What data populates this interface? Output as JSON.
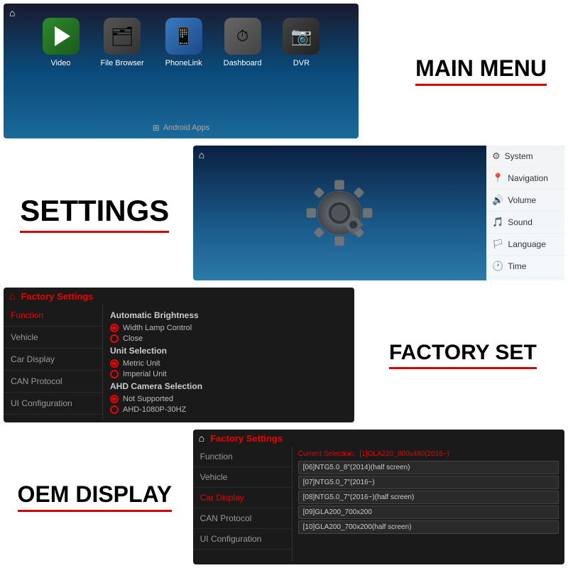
{
  "header": {
    "home_icon": "⌂"
  },
  "main_menu": {
    "title": "MAIN MENU",
    "icons": [
      {
        "id": "video",
        "label": "Video",
        "icon": "▶"
      },
      {
        "id": "file_browser",
        "label": "File Browser",
        "icon": "📁"
      },
      {
        "id": "phonelink",
        "label": "PhoneLink",
        "icon": "📱"
      },
      {
        "id": "dashboard",
        "label": "Dashboard",
        "icon": "🕐"
      },
      {
        "id": "dvr",
        "label": "DVR",
        "icon": "📷"
      }
    ],
    "android_apps": "Android Apps"
  },
  "settings": {
    "title": "SETTINGS",
    "menu_items": [
      {
        "id": "system",
        "label": "System",
        "icon": "⚙"
      },
      {
        "id": "navigation",
        "label": "Navigation",
        "icon": "📍"
      },
      {
        "id": "volume",
        "label": "Volume",
        "icon": "🔊"
      },
      {
        "id": "sound",
        "label": "Sound",
        "icon": "🎵"
      },
      {
        "id": "language",
        "label": "Language",
        "icon": "🏳"
      },
      {
        "id": "time",
        "label": "Time",
        "icon": "🕐"
      }
    ]
  },
  "factory_set": {
    "title": "FACTORY SET",
    "top_bar_title": "Factory Settings",
    "sidebar_items": [
      {
        "id": "function",
        "label": "Function",
        "active": true
      },
      {
        "id": "vehicle",
        "label": "Vehicle"
      },
      {
        "id": "car_display",
        "label": "Car Display"
      },
      {
        "id": "can_protocol",
        "label": "CAN Protocol"
      },
      {
        "id": "ui_config",
        "label": "UI Configuration"
      }
    ],
    "sections": [
      {
        "title": "Automatic Brightness",
        "options": [
          {
            "label": "Width Lamp Control",
            "selected": true
          },
          {
            "label": "Close",
            "selected": false
          }
        ]
      },
      {
        "title": "Unit Selection",
        "options": [
          {
            "label": "Metric Unit",
            "selected": true
          },
          {
            "label": "Imperial Unit",
            "selected": false
          }
        ]
      },
      {
        "title": "AHD Camera Selection",
        "options": [
          {
            "label": "Not Supported",
            "selected": true
          },
          {
            "label": "AHD-1080P-30HZ",
            "selected": false
          }
        ]
      }
    ]
  },
  "oem_display": {
    "title": "OEM DISPLAY",
    "top_bar_title": "Factory Settings",
    "sidebar_items": [
      {
        "id": "function",
        "label": "Function"
      },
      {
        "id": "vehicle",
        "label": "Vehicle"
      },
      {
        "id": "car_display",
        "label": "Car Display",
        "active": true
      },
      {
        "id": "can_protocol",
        "label": "CAN Protocol"
      },
      {
        "id": "ui_config",
        "label": "UI Configuration"
      }
    ],
    "current_selection_label": "Current Selection:",
    "current_selection_value": "[1]GLA220_800x480(2016~)",
    "list_items": [
      "[06]NTG5.0_8\"(2014)(half screen)",
      "[07]NTG5.0_7\"(2016~)",
      "[08]NTG5.0_7\"(2016~)(half screen)",
      "[09]GLA200_700x200",
      "[10]GLA200_700x200(half screen)"
    ]
  }
}
